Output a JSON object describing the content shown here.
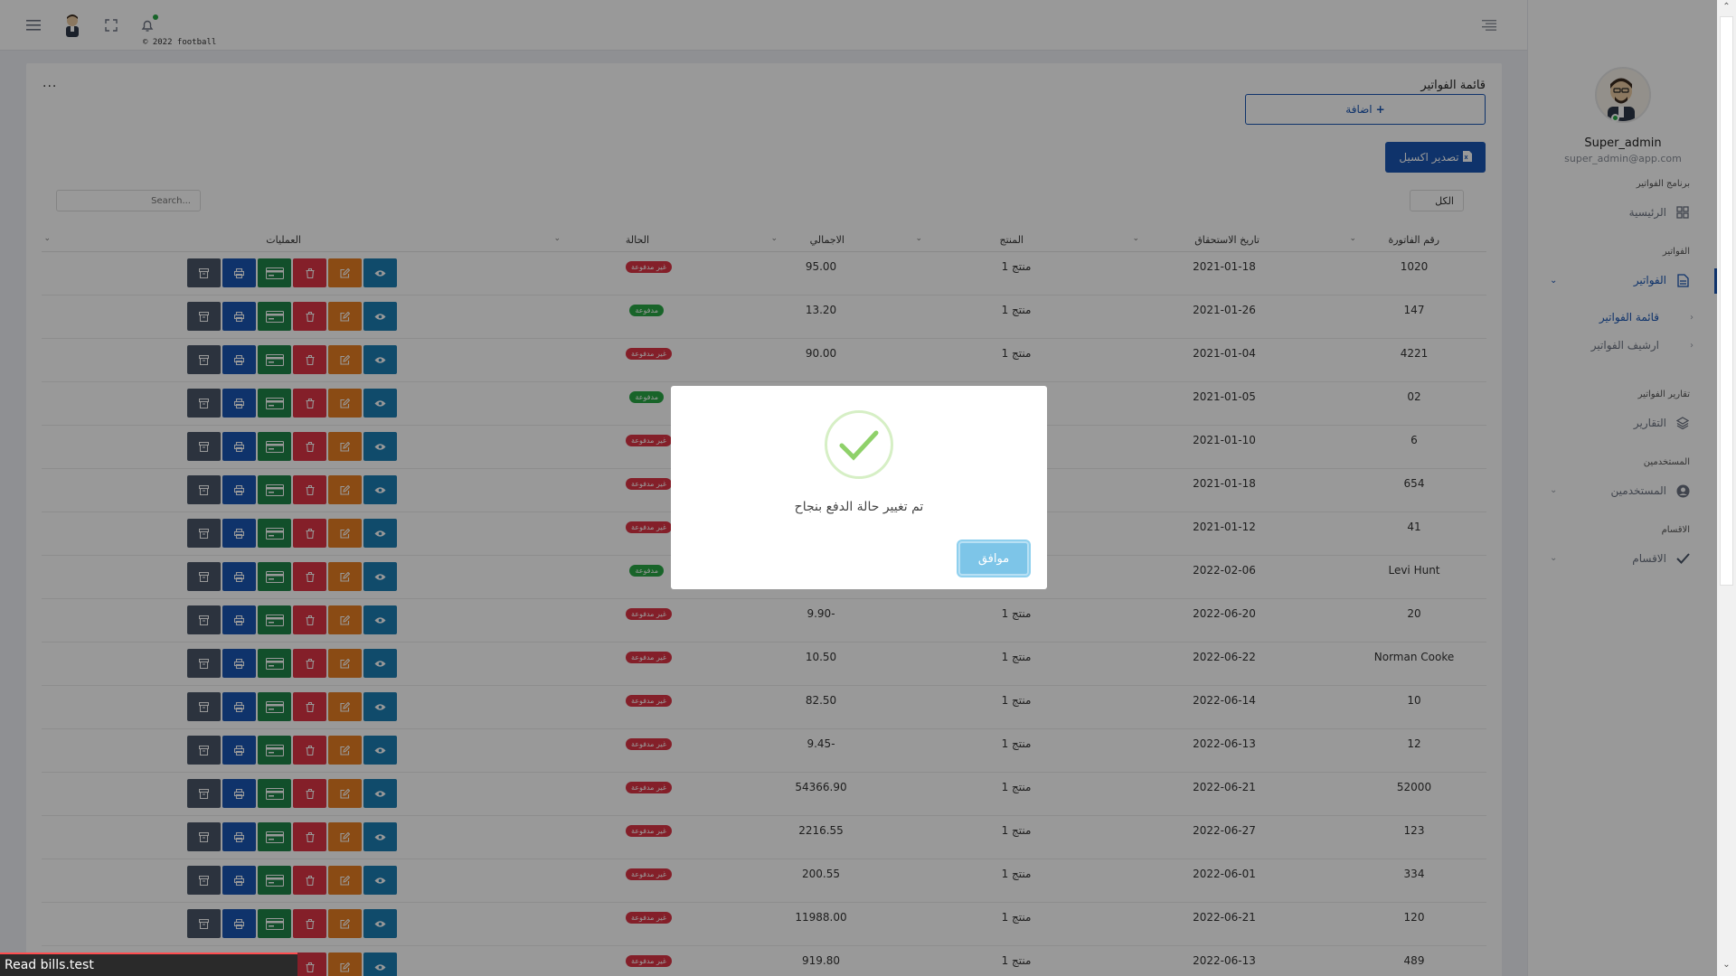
{
  "topbar": {
    "menu_icon": "hamburger-icon",
    "avatar_icon": "user-avatar-icon",
    "fullscreen_icon": "fullscreen-icon",
    "bell_icon": "bell-icon",
    "copyright": "© 2022 football",
    "collapse_icon": "align-right-icon"
  },
  "sidebar": {
    "user_name": "Super_admin",
    "user_email": "super_admin@app.com",
    "section_program": "برنامج الفواتير",
    "home_label": "الرئيسية",
    "section_invoices": "الفواتير",
    "invoices_label": "الفواتير",
    "sub_list": "قائمة الفواتير",
    "sub_archive": "ارشيف الفواتير",
    "section_reports": "تقارير الفواتير",
    "reports_label": "التقارير",
    "section_users": "المستخدمين",
    "users_label": "المستخدمين",
    "section_categories": "الاقسام",
    "categories_label": "الاقسام"
  },
  "card": {
    "title": "قائمة الفواتير",
    "dots": "...",
    "add_label": "اضافة",
    "export_label": "تصدير اكسيل",
    "filter_value": "الكل",
    "search_placeholder": "Search..."
  },
  "table": {
    "headers": {
      "invoice_number": "رقم الفاتورة",
      "due_date": "تاريخ الاستحقاق",
      "product": "المنتج",
      "total": "الاجمالي",
      "status": "الحالة",
      "operations": "العمليات"
    },
    "rows": [
      {
        "number": "1020",
        "date": "2021-01-18",
        "product": "منتج 1",
        "total": "95.00",
        "status": "غير مدفوعة",
        "paid": false
      },
      {
        "number": "147",
        "date": "2021-01-26",
        "product": "منتج 1",
        "total": "13.20",
        "status": "مدفوعة",
        "paid": true
      },
      {
        "number": "4221",
        "date": "2021-01-04",
        "product": "منتج 1",
        "total": "90.00",
        "status": "غير مدفوعة",
        "paid": false
      },
      {
        "number": "02",
        "date": "2021-01-05",
        "product": "",
        "total": "",
        "status": "مدفوعة",
        "paid": true
      },
      {
        "number": "6",
        "date": "2021-01-10",
        "product": "",
        "total": "",
        "status": "غير مدفوعة",
        "paid": false
      },
      {
        "number": "654",
        "date": "2021-01-18",
        "product": "",
        "total": "",
        "status": "غير مدفوعة",
        "paid": false
      },
      {
        "number": "41",
        "date": "2021-01-12",
        "product": "",
        "total": "",
        "status": "غير مدفوعة",
        "paid": false
      },
      {
        "number": "Levi Hunt",
        "date": "2022-02-06",
        "product": "",
        "total": "",
        "status": "مدفوعة",
        "paid": true
      },
      {
        "number": "20",
        "date": "2022-06-20",
        "product": "منتج 1",
        "total": "9.90-",
        "status": "غير مدفوعة",
        "paid": false
      },
      {
        "number": "Norman Cooke",
        "date": "2022-06-22",
        "product": "منتج 1",
        "total": "10.50",
        "status": "غير مدفوعة",
        "paid": false
      },
      {
        "number": "10",
        "date": "2022-06-14",
        "product": "منتج 1",
        "total": "82.50",
        "status": "غير مدفوعة",
        "paid": false
      },
      {
        "number": "12",
        "date": "2022-06-13",
        "product": "منتج 1",
        "total": "9.45-",
        "status": "غير مدفوعة",
        "paid": false
      },
      {
        "number": "52000",
        "date": "2022-06-21",
        "product": "منتج 1",
        "total": "54366.90",
        "status": "غير مدفوعة",
        "paid": false
      },
      {
        "number": "123",
        "date": "2022-06-27",
        "product": "منتج 1",
        "total": "2216.55",
        "status": "غير مدفوعة",
        "paid": false
      },
      {
        "number": "334",
        "date": "2022-06-01",
        "product": "منتج 1",
        "total": "200.55",
        "status": "غير مدفوعة",
        "paid": false
      },
      {
        "number": "120",
        "date": "2022-06-21",
        "product": "منتج 1",
        "total": "11988.00",
        "status": "غير مدفوعة",
        "paid": false
      },
      {
        "number": "489",
        "date": "2022-06-13",
        "product": "منتج 1",
        "total": "919.80",
        "status": "غير مدفوعة",
        "paid": false
      }
    ]
  },
  "modal": {
    "icon": "success-check-icon",
    "message": "تم تغيير حالة الدفع بنجاح",
    "ok_label": "موافق"
  },
  "statusbar": {
    "text": "Read bills.test"
  },
  "colors": {
    "primary": "#1a56b3",
    "paid": "#28a745",
    "unpaid": "#dc3545"
  }
}
